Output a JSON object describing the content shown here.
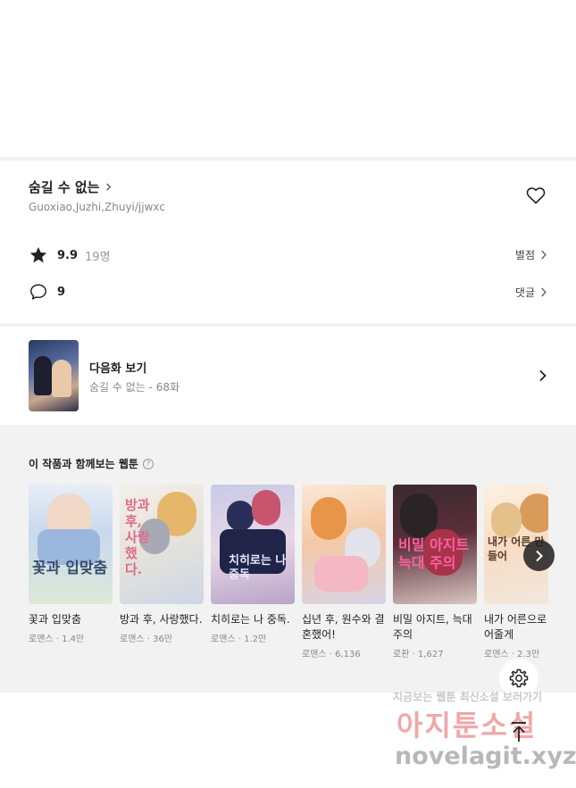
{
  "work": {
    "title": "숨길 수 없는",
    "authors": "Guoxiao,Juzhi,Zhuyi/jjwxc"
  },
  "rating": {
    "value": "9.9",
    "count": "19명",
    "link_label": "별점"
  },
  "comments": {
    "count": "9",
    "link_label": "댓글"
  },
  "next_episode": {
    "title": "다음화 보기",
    "subtitle": "숨길 수 없는 - 68화"
  },
  "recommendations": {
    "heading": "이 작품과 함께보는 웹툰",
    "help_glyph": "?",
    "items": [
      {
        "name": "꽃과 입맞춤",
        "meta": "로맨스 · 1.4만",
        "cover_text": "꽃과 입맞춤"
      },
      {
        "name": "방과 후, 사랑했다.",
        "meta": "로맨스 · 36만",
        "cover_text": "방과 후, 사랑했다."
      },
      {
        "name": "치히로는 나 중독.",
        "meta": "로맨스 · 1.2만",
        "cover_text": "치히로는 나 중독"
      },
      {
        "name": "십년 후, 원수와 결혼했어!",
        "meta": "로맨스 · 6,136",
        "cover_text": ""
      },
      {
        "name": "비밀 아지트, 늑대 주의",
        "meta": "로판 · 1,627",
        "cover_text": "비밀 아지트 늑대 주의"
      },
      {
        "name": "내가 어른으로 들어줄게",
        "meta": "로맨스 · 2.3만",
        "cover_text": "내가 어른 만들어"
      }
    ]
  },
  "watermark": {
    "line1": "지금보는 웹툰 최신소설 보러가기",
    "line2": "아지툰소설",
    "line3": "novelagit.xyz"
  },
  "icons": {
    "heart": "heart-outline-icon",
    "star": "star-icon",
    "comment": "comment-bubble-icon",
    "settings": "gear-icon",
    "scroll_top": "arrow-up-icon"
  },
  "colors": {
    "background_gray": "#f2f2f2",
    "text_primary": "#222222",
    "text_secondary": "#888888"
  }
}
